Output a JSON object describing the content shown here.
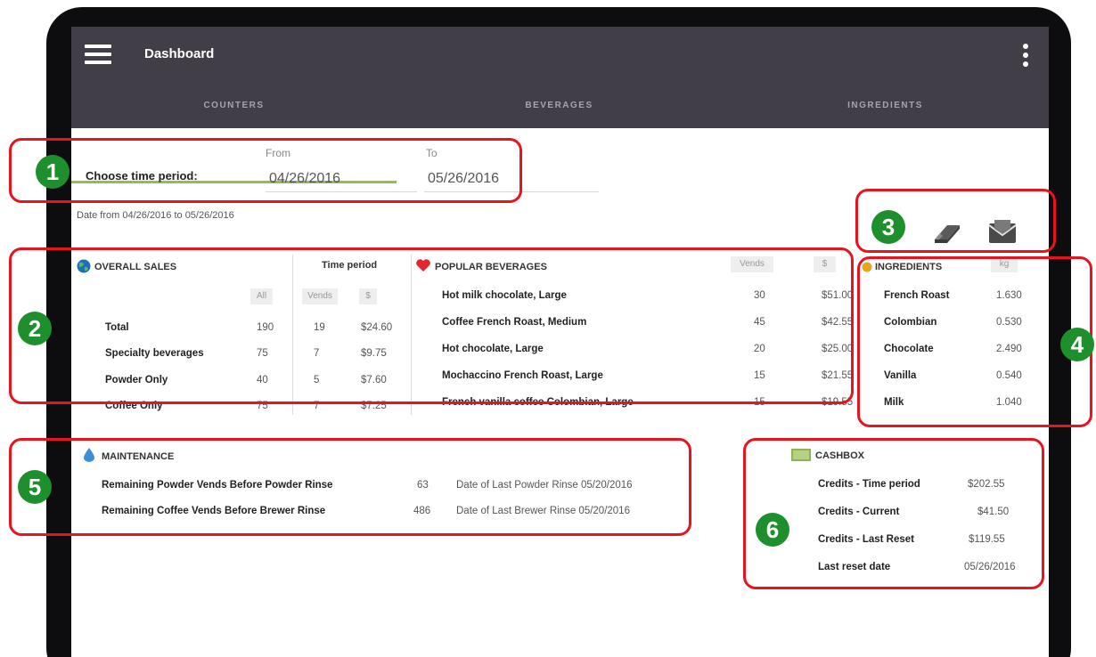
{
  "app": {
    "title": "Dashboard"
  },
  "tabs": [
    {
      "label": "COUNTERS",
      "active": true
    },
    {
      "label": "BEVERAGES",
      "active": false
    },
    {
      "label": "INGREDIENTS",
      "active": false
    }
  ],
  "period": {
    "label": "Choose time period:",
    "from_label": "From",
    "to_label": "To",
    "from_value": "04/26/2016",
    "to_value": "05/26/2016",
    "range_text": "Date from 04/26/2016 to 05/26/2016"
  },
  "overall_sales": {
    "title": "OVERALL SALES",
    "time_period_label": "Time period",
    "headers": {
      "all": "All",
      "vends": "Vends",
      "dollars": "$"
    },
    "rows": [
      {
        "label": "Total",
        "all": "190",
        "vends": "19",
        "amount": "$24.60"
      },
      {
        "label": "Specialty beverages",
        "all": "75",
        "vends": "7",
        "amount": "$9.75"
      },
      {
        "label": "Powder Only",
        "all": "40",
        "vends": "5",
        "amount": "$7.60"
      },
      {
        "label": "Coffee Only",
        "all": "75",
        "vends": "7",
        "amount": "$7.25"
      }
    ]
  },
  "popular_beverages": {
    "title": "POPULAR BEVERAGES",
    "headers": {
      "vends": "Vends",
      "dollars": "$"
    },
    "rows": [
      {
        "name": "Hot milk chocolate, Large",
        "vends": "30",
        "amount": "$51.00"
      },
      {
        "name": "Coffee French Roast, Medium",
        "vends": "45",
        "amount": "$42.55"
      },
      {
        "name": "Hot chocolate, Large",
        "vends": "20",
        "amount": "$25.00"
      },
      {
        "name": "Mochaccino French Roast, Large",
        "vends": "15",
        "amount": "$21.55"
      },
      {
        "name": "French vanilla coffee Colombian, Large",
        "vends": "15",
        "amount": "$19.55"
      }
    ]
  },
  "ingredients": {
    "title": "INGREDIENTS",
    "unit": "kg",
    "rows": [
      {
        "name": "French Roast",
        "value": "1.630"
      },
      {
        "name": "Colombian",
        "value": "0.530"
      },
      {
        "name": "Chocolate",
        "value": "2.490"
      },
      {
        "name": "Vanilla",
        "value": "0.540"
      },
      {
        "name": "Milk",
        "value": "1.040"
      }
    ]
  },
  "maintenance": {
    "title": "MAINTENANCE",
    "rows": [
      {
        "label": "Remaining Powder Vends Before Powder Rinse",
        "value": "63",
        "note": "Date of Last Powder Rinse 05/20/2016"
      },
      {
        "label": "Remaining Coffee Vends Before Brewer Rinse",
        "value": "486",
        "note": "Date of Last Brewer Rinse 05/20/2016"
      }
    ]
  },
  "cashbox": {
    "title": "CASHBOX",
    "rows": [
      {
        "label": "Credits - Time period",
        "value": "$202.55"
      },
      {
        "label": "Credits - Current",
        "value": "$41.50"
      },
      {
        "label": "Credits - Last Reset",
        "value": "$119.55"
      },
      {
        "label": "Last reset date",
        "value": "05/26/2016"
      }
    ]
  },
  "callouts": [
    "1",
    "2",
    "3",
    "4",
    "5",
    "6"
  ],
  "colors": {
    "appbar": "#413e48",
    "tab_indicator": "#8bc34a",
    "callout_border": "#e6141e",
    "callout_badge": "#1d8f2d"
  }
}
